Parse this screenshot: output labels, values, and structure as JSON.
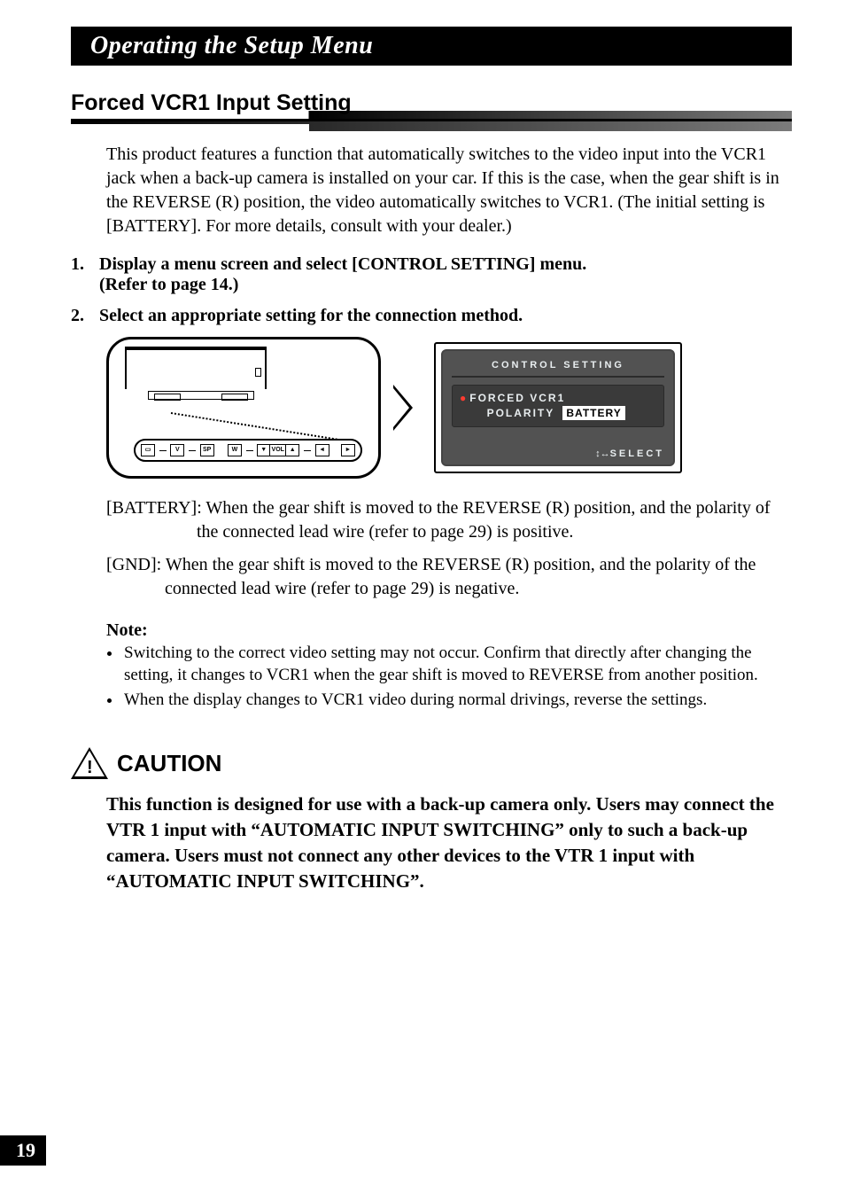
{
  "banner": "Operating the Setup Menu",
  "section_heading": "Forced VCR1 Input Setting",
  "intro": "This product features a function that automatically switches to the video input into the VCR1 jack when a back-up camera is installed on your car. If this is the case, when the gear shift is in the REVERSE (R) position, the video automatically switches to VCR1. (The initial setting is [BATTERY]. For more details, consult with your dealer.)",
  "steps": [
    {
      "num": "1.",
      "line1": "Display a menu screen and select [CONTROL SETTING] menu.",
      "line2": "(Refer to page 14.)"
    },
    {
      "num": "2.",
      "line1": "Select an appropriate setting for the connection method."
    }
  ],
  "remote_buttons": {
    "v": "V",
    "sp": "SP",
    "w": "W",
    "vol_down": "▼",
    "vol": "VOL",
    "vol_up": "▲",
    "left": "◄",
    "right": "►",
    "disp": "▭"
  },
  "osd": {
    "title": "CONTROL SETTING",
    "line1": "FORCED VCR1",
    "line2_key": "POLARITY",
    "line2_val": "BATTERY",
    "select": "SELECT",
    "arrows": "↕↔"
  },
  "option_battery": "[BATTERY]: When the gear shift is moved to the REVERSE (R) position, and the polarity of the connected lead wire (refer to page 29) is positive.",
  "option_gnd": "[GND]: When the gear shift is moved to the REVERSE (R) position, and the polarity of the connected lead wire (refer to page 29) is negative.",
  "note_title": "Note:",
  "notes": [
    "Switching to the correct video setting may not occur. Confirm that directly after changing the setting, it changes to VCR1 when the gear shift is moved to REVERSE from another position.",
    "When the display changes to VCR1 video during normal drivings, reverse the settings."
  ],
  "caution_label": "CAUTION",
  "caution_text": "This function is designed for use with a back-up camera only. Users may connect the VTR 1 input with “AUTOMATIC INPUT SWITCHING” only to such a back-up camera. Users must not connect any other devices to the VTR 1 input with “AUTOMATIC INPUT SWITCHING”.",
  "page_number": "19"
}
